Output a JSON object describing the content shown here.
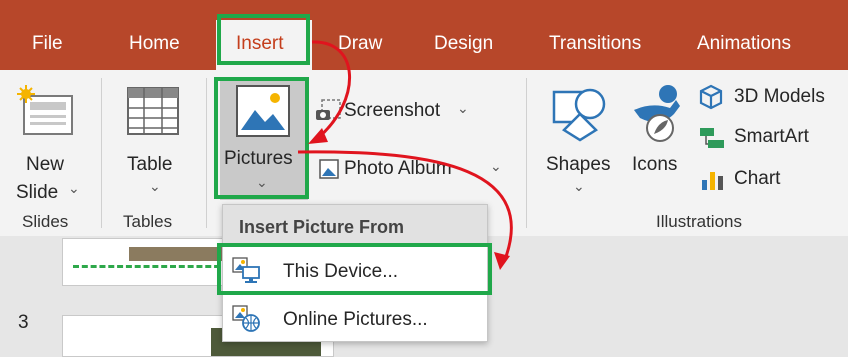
{
  "tabs": [
    "File",
    "Home",
    "Insert",
    "Draw",
    "Design",
    "Transitions",
    "Animations"
  ],
  "active_tab": "Insert",
  "ribbon": {
    "new_slide": {
      "line1": "New",
      "line2": "Slide",
      "caret": "⌄"
    },
    "table": {
      "label": "Table",
      "caret": "⌄"
    },
    "pictures": {
      "label": "Pictures",
      "caret": "⌄"
    },
    "screenshot": {
      "label": "Screenshot",
      "caret": "⌄"
    },
    "photo_album": {
      "label": "Photo Album",
      "caret": "⌄"
    },
    "shapes": {
      "label": "Shapes",
      "caret": "⌄"
    },
    "icons": {
      "label": "Icons"
    },
    "models_3d": {
      "label": "3D Models",
      "caret": "⌄"
    },
    "smartart": {
      "label": "SmartArt"
    },
    "chart": {
      "label": "Chart"
    },
    "groups": {
      "slides": "Slides",
      "tables": "Tables",
      "illustrations": "Illustrations"
    }
  },
  "insert_picture_menu": {
    "header": "Insert Picture From",
    "items": [
      {
        "label": "This Device...",
        "icon": "device-picture-icon"
      },
      {
        "label": "Online Pictures...",
        "icon": "online-picture-icon"
      }
    ]
  },
  "slide_panel": {
    "slide_number": "3"
  },
  "colors": {
    "tab_bar": "#b7472a",
    "ribbon": "#f3f3f3",
    "highlight_box": "#20a84a",
    "annotation_arrow": "#e0141e"
  }
}
